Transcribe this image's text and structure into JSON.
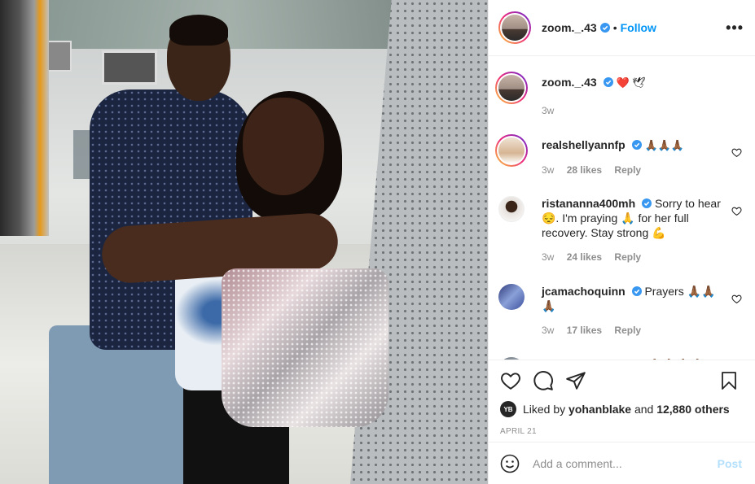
{
  "header": {
    "username": "zoom._.43",
    "separator": "•",
    "follow_label": "Follow",
    "more_label": "•••"
  },
  "caption": {
    "username": "zoom._.43",
    "emoji": "❤️ 🕊",
    "time": "3w"
  },
  "comments": [
    {
      "username": "realshellyannfp",
      "text": "🙏🏾🙏🏾🙏🏾",
      "time": "3w",
      "likes": "28 likes",
      "reply": "Reply"
    },
    {
      "username": "ristananna400mh",
      "text": "Sorry to hear 😔. I'm praying 🙏 for her full recovery. Stay strong 💪",
      "time": "3w",
      "likes": "24 likes",
      "reply": "Reply"
    },
    {
      "username": "jcamachoquinn",
      "text": "Prayers 🙏🏾🙏🏾🙏🏾",
      "time": "3w",
      "likes": "17 likes",
      "reply": "Reply"
    },
    {
      "username": "zharnel_hughes",
      "text": "🙏🏾🙏🏾🙏🏾🙏🏾",
      "time": "",
      "likes": "",
      "reply": ""
    }
  ],
  "likes": {
    "avatar_text": "YB",
    "prefix": "Liked by ",
    "user": "yohanblake",
    "middle": " and ",
    "count": "12,880 others"
  },
  "date": "APRIL 21",
  "add_comment": {
    "placeholder": "Add a comment...",
    "post_label": "Post"
  },
  "colors": {
    "accent": "#0095f6",
    "heart": "#ed4956",
    "muted": "#8e8e8e",
    "post_disabled": "#b2dffc"
  }
}
